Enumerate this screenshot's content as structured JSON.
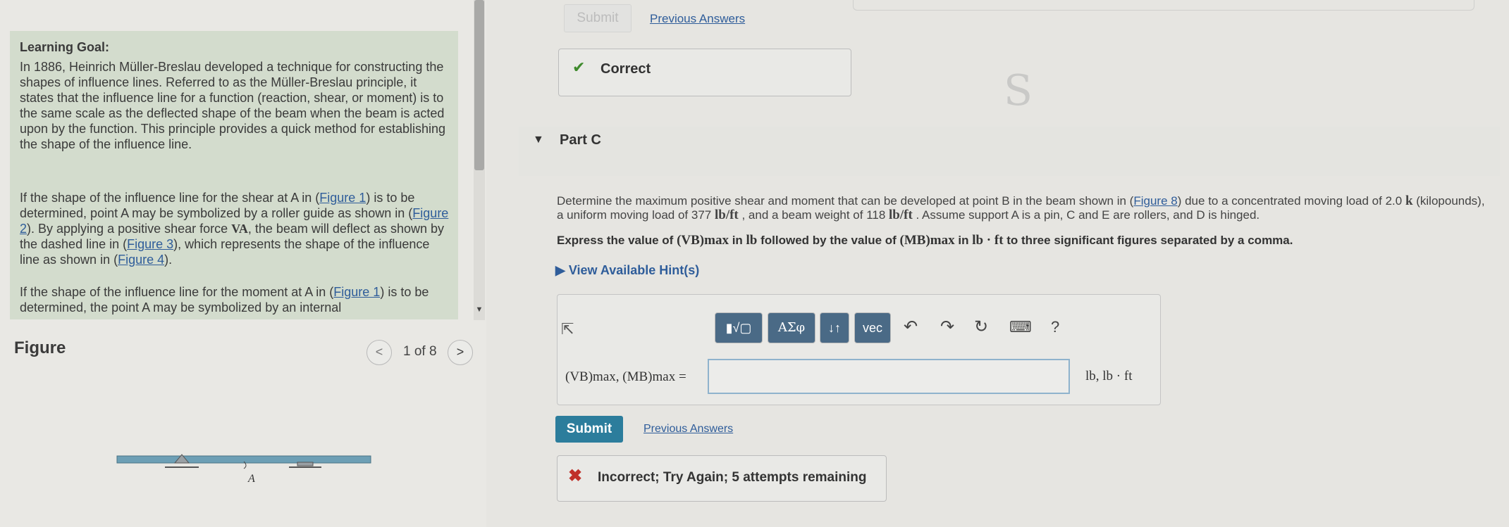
{
  "learning_goal": {
    "title": "Learning Goal:",
    "p1": "In 1886, Heinrich Müller-Breslau developed a technique for constructing the shapes of influence lines. Referred to as the Müller-Breslau principle, it states that the influence line for a function (reaction, shear, or moment) is to the same scale as the deflected shape of the beam when the beam is acted upon by the function. This principle provides a quick method for establishing the shape of the influence line.",
    "p2_a": "If the shape of the influence line for the shear at A in (",
    "p2_link1": "Figure 1",
    "p2_b": ") is to be determined, point A may be symbolized by a roller guide as shown in (",
    "p2_link2": "Figure 2",
    "p2_c": "). By applying a positive shear force ",
    "p2_math": "VA",
    "p2_d": ", the beam will deflect as shown by the dashed line in (",
    "p2_link3": "Figure 3",
    "p2_e": "), which represents the shape of the influence line as shown in (",
    "p2_link4": "Figure 4",
    "p2_f": ").",
    "p3_a": "If the shape of the influence line for the moment at A in (",
    "p3_link1": "Figure 1",
    "p3_b": ") is to be determined, the point A may be symbolized by an internal"
  },
  "figure": {
    "label": "Figure",
    "counter": "1 of 8",
    "prev": "<",
    "next": ">",
    "point_label": "A"
  },
  "top": {
    "submit": "Submit",
    "previous_answers": "Previous Answers",
    "correct": "Correct",
    "correct_icon": "✔"
  },
  "part": {
    "title": "Part C",
    "arrow": "▼"
  },
  "problem": {
    "t1": "Determine the maximum positive shear and moment that can be developed at point B in the beam shown in (",
    "link": "Figure 8",
    "t2": ") due to a concentrated moving load of 2.0 ",
    "m1": "k",
    "t3": " (kilopounds), a uniform moving load of 377 ",
    "m2": "lb/ft",
    "t4": " , and a beam weight of 118 ",
    "m3": "lb/ft",
    "t5": " . Assume support A is a pin, C and E are rollers, and D is hinged.",
    "e1": "Express the value of ",
    "em1": "(VB)max",
    "e2": " in ",
    "em2": "lb",
    "e3": " followed by the value of ",
    "em3": "(MB)max",
    "e4": " in ",
    "em4": "lb · ft",
    "e5": " to three significant figures separated by a comma.",
    "hints": "View Available Hint(s)",
    "hints_arrow": "▶"
  },
  "toolbar": {
    "templates": "▮√▢",
    "greek": "ΑΣφ",
    "updown": "↓↑",
    "vec": "vec",
    "undo": "↶",
    "redo": "↷",
    "reset": "↻",
    "keyboard": "⌨",
    "help": "?"
  },
  "answer": {
    "label": "(VB)max, (MB)max =",
    "value": "",
    "units": "lb, lb · ft"
  },
  "bottom": {
    "submit": "Submit",
    "previous_answers": "Previous Answers",
    "incorrect": "Incorrect; Try Again; 5 attempts remaining",
    "incorrect_icon": "✖"
  },
  "colors": {
    "submit_blue": "#2c7d9c",
    "link_blue": "#2f5d9a",
    "learning_bg": "#d3dccd",
    "correct_green": "#3e8a2c",
    "incorrect_red": "#c0302a"
  }
}
